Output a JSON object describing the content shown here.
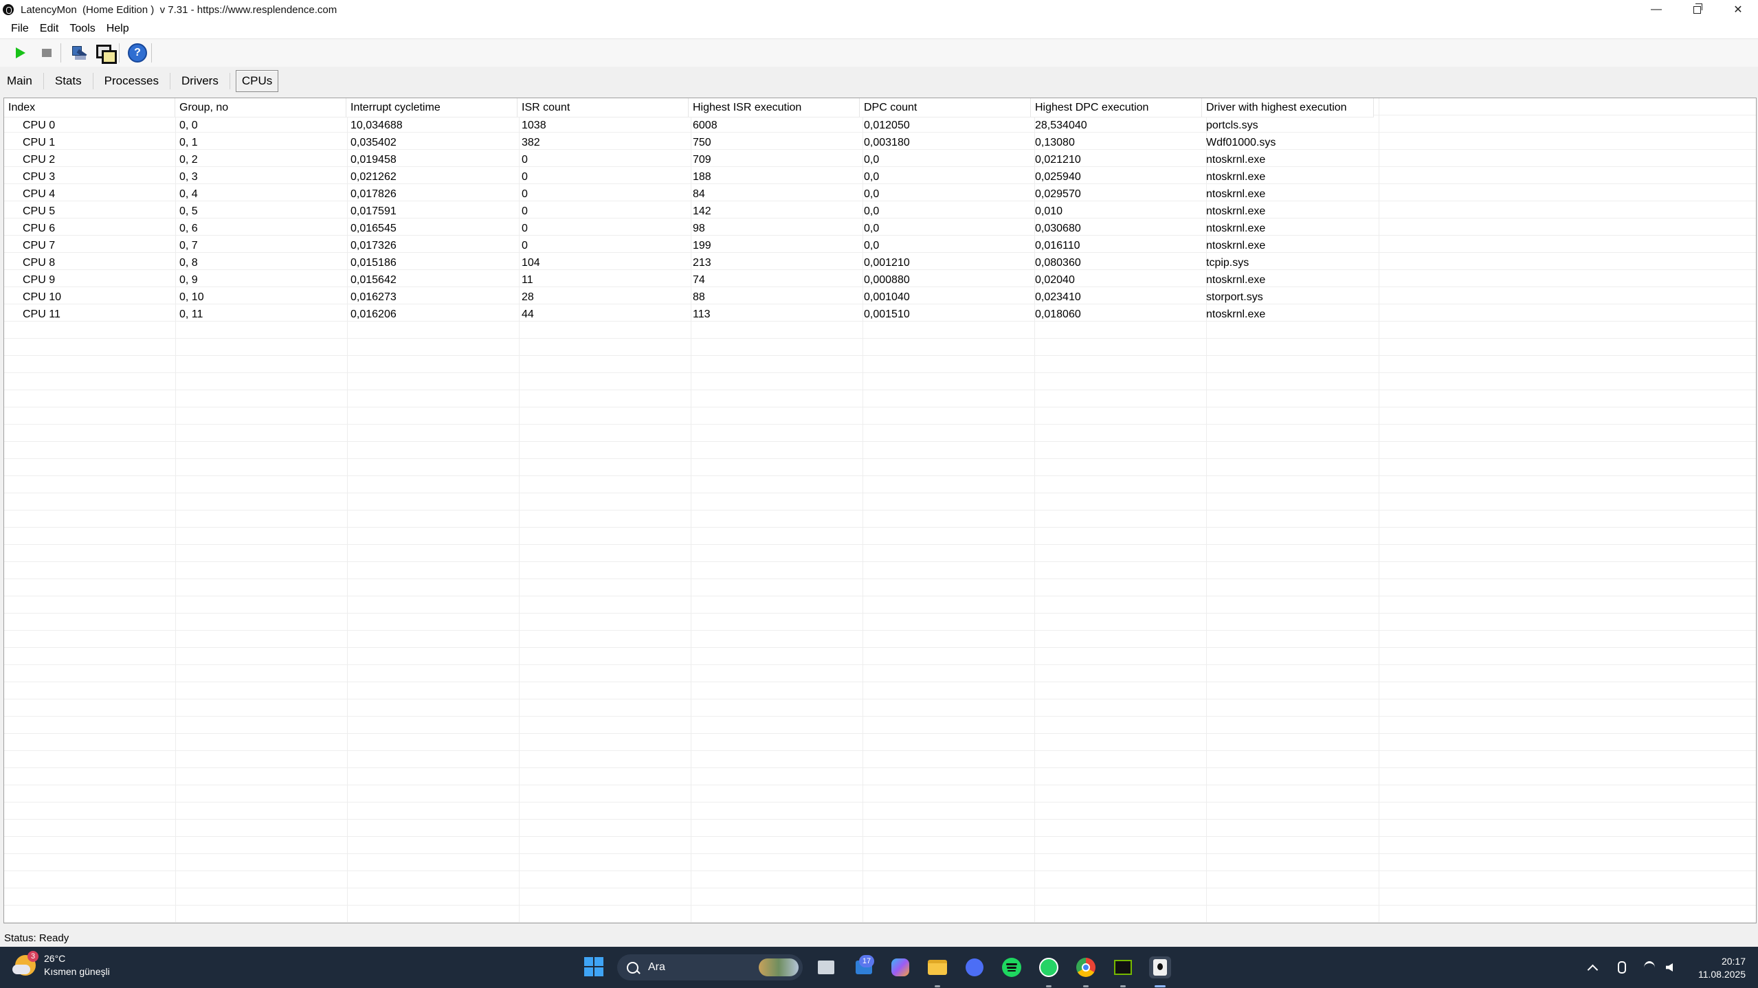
{
  "window": {
    "title": "LatencyMon  (Home Edition )  v 7.31 - https://www.resplendence.com",
    "minimize": "—",
    "close": "✕"
  },
  "menu": [
    "File",
    "Edit",
    "Tools",
    "Help"
  ],
  "toolbar": {
    "buttons": [
      "play-icon",
      "stop-icon",
      "select-target-icon",
      "windows-icon",
      "help-icon"
    ],
    "help_glyph": "?"
  },
  "tabs": [
    {
      "label": "Main",
      "active": false
    },
    {
      "label": "Stats",
      "active": false
    },
    {
      "label": "Processes",
      "active": false
    },
    {
      "label": "Drivers",
      "active": false
    },
    {
      "label": "CPUs",
      "active": true
    }
  ],
  "table": {
    "columns": [
      "Index",
      "Group, no",
      "Interrupt cycletime",
      "ISR count",
      "Highest ISR execution",
      "DPC count",
      "Highest DPC execution",
      "Driver with highest execution"
    ],
    "rows": [
      [
        "CPU 0",
        "0, 0",
        "10,034688",
        "1038",
        "6008",
        "0,012050",
        "28,534040",
        "portcls.sys"
      ],
      [
        "CPU 1",
        "0, 1",
        "0,035402",
        "382",
        "750",
        "0,003180",
        "0,13080",
        "Wdf01000.sys"
      ],
      [
        "CPU 2",
        "0, 2",
        "0,019458",
        "0",
        "709",
        "0,0",
        "0,021210",
        "ntoskrnl.exe"
      ],
      [
        "CPU 3",
        "0, 3",
        "0,021262",
        "0",
        "188",
        "0,0",
        "0,025940",
        "ntoskrnl.exe"
      ],
      [
        "CPU 4",
        "0, 4",
        "0,017826",
        "0",
        "84",
        "0,0",
        "0,029570",
        "ntoskrnl.exe"
      ],
      [
        "CPU 5",
        "0, 5",
        "0,017591",
        "0",
        "142",
        "0,0",
        "0,010",
        "ntoskrnl.exe"
      ],
      [
        "CPU 6",
        "0, 6",
        "0,016545",
        "0",
        "98",
        "0,0",
        "0,030680",
        "ntoskrnl.exe"
      ],
      [
        "CPU 7",
        "0, 7",
        "0,017326",
        "0",
        "199",
        "0,0",
        "0,016110",
        "ntoskrnl.exe"
      ],
      [
        "CPU 8",
        "0, 8",
        "0,015186",
        "104",
        "213",
        "0,001210",
        "0,080360",
        "tcpip.sys"
      ],
      [
        "CPU 9",
        "0, 9",
        "0,015642",
        "11",
        "74",
        "0,000880",
        "0,02040",
        "ntoskrnl.exe"
      ],
      [
        "CPU 10",
        "0, 10",
        "0,016273",
        "28",
        "88",
        "0,001040",
        "0,023410",
        "storport.sys"
      ],
      [
        "CPU 11",
        "0, 11",
        "0,016206",
        "44",
        "113",
        "0,001510",
        "0,018060",
        "ntoskrnl.exe"
      ]
    ]
  },
  "status": "Status: Ready",
  "taskbar": {
    "weather": {
      "badge": "3",
      "temp": "26°C",
      "desc": "Kısmen güneşli"
    },
    "search_placeholder": "Ara",
    "mail_badge": "17",
    "apps": [
      "task-view-icon",
      "mail-icon",
      "copilot-icon",
      "file-explorer-icon",
      "app-icon",
      "spotify-icon",
      "whatsapp-icon",
      "chrome-icon",
      "nvidia-icon",
      "latencymon-icon"
    ],
    "clock": {
      "time": "20:17",
      "date": "11.08.2025"
    }
  }
}
